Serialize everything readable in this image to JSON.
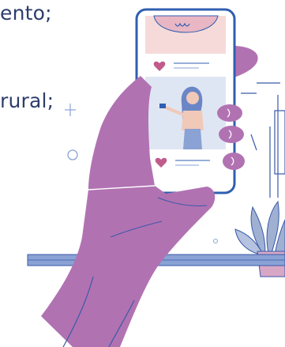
{
  "text_fragments": {
    "line_top": "ento;",
    "line_middle": "rural;"
  },
  "colors": {
    "text": "#2d3d6b",
    "hand": "#b172b2",
    "hand_shadow": "#9c5aa0",
    "phone_frame": "#2f5fb0",
    "phone_screen": "#ffffff",
    "post_background": "#f6dada",
    "accent_pink": "#c05c8c",
    "plant": "#9fb0d3",
    "pot": "#d8a7c6",
    "line_art": "#3a5aa8"
  },
  "icons": [
    "heart-icon",
    "heart-icon",
    "plus-icon",
    "circle-icon"
  ]
}
